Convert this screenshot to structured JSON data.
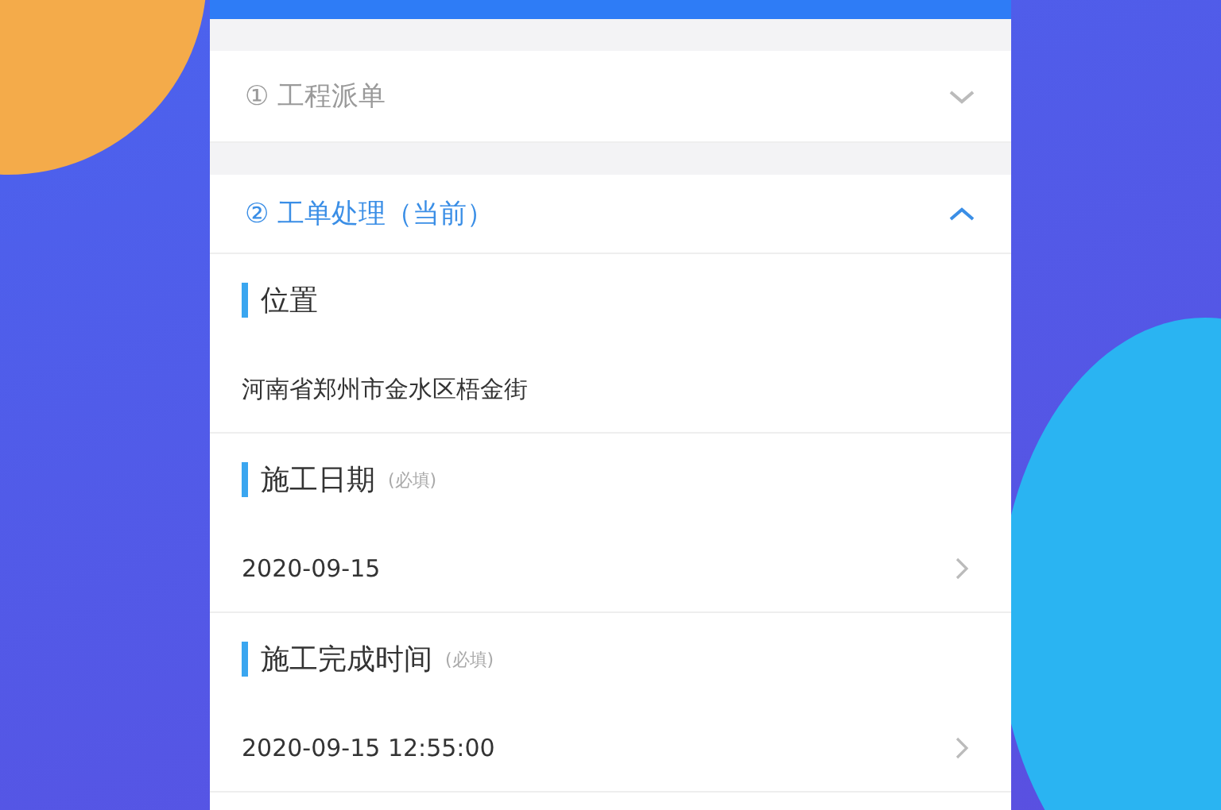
{
  "steps": [
    {
      "label": "① 工程派单",
      "expanded": false,
      "current": false
    },
    {
      "label": "② 工单处理（当前）",
      "expanded": true,
      "current": true
    }
  ],
  "fields": [
    {
      "kind": "text",
      "label": "位置",
      "value": "河南省郑州市金水区梧金街"
    },
    {
      "kind": "picker",
      "label": "施工日期",
      "hint": "(必填)",
      "value": "2020-09-15"
    },
    {
      "kind": "picker",
      "label": "施工完成时间",
      "hint": "(必填)",
      "value": "2020-09-15 12:55:00"
    }
  ]
}
